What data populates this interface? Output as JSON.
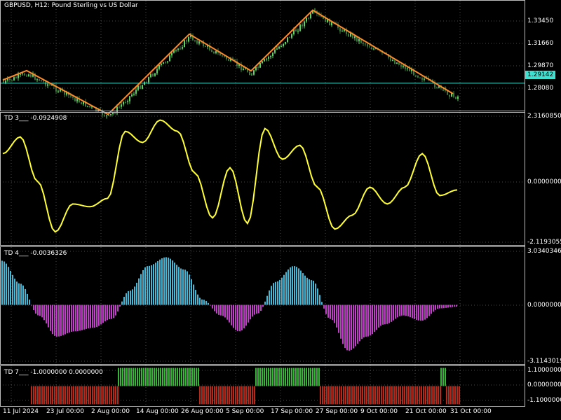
{
  "window": {
    "title": "GBPUSD, H12:  Pound Sterling vs US Dollar",
    "current_price": "1.29142"
  },
  "colors": {
    "background": "#000000",
    "grid": "#4a4a4a",
    "candle_up": "#5fd35f",
    "candle_down": "#3a7a3a",
    "zigzag": "#ff8a2a",
    "price_line": "#40e0d0",
    "td3_line": "#ffff33",
    "td4_pos": "#44b8d4",
    "td4_neg": "#c040c8",
    "td7_pos": "#36b536",
    "td7_neg": "#b52a1a"
  },
  "price_axis": [
    "1.33450",
    "1.31660",
    "1.29870",
    "1.28080"
  ],
  "time_axis": [
    "11 Jul 2024",
    "23 Jul 00:00",
    "2 Aug 00:00",
    "14 Aug 00:00",
    "26 Aug 00:00",
    "5 Sep 00:00",
    "17 Sep 00:00",
    "27 Sep 00:00",
    "9 Oct 00:00",
    "21 Oct 00:00",
    "31 Oct 00:00"
  ],
  "panels": {
    "td3": {
      "label": "TD 3___  -0.0924908",
      "axis": [
        "2.3160850",
        "0.0000000",
        "-2.1193055"
      ]
    },
    "td4": {
      "label": "TD 4___  -0.0036326",
      "axis": [
        "3.0340346",
        "0.0000000",
        "-3.1143019"
      ]
    },
    "td7": {
      "label": "TD 7___  -1.0000000 0.0000000",
      "axis": [
        "1.1000000",
        "0.0000000",
        "-1.1000000"
      ]
    }
  },
  "chart_data": {
    "type": "line",
    "x": [
      "11 Jul 2024",
      "23 Jul 00:00",
      "2 Aug 00:00",
      "14 Aug 00:00",
      "26 Aug 00:00",
      "5 Sep 00:00",
      "17 Sep 00:00",
      "27 Sep 00:00",
      "9 Oct 00:00",
      "21 Oct 00:00",
      "31 Oct 00:00"
    ],
    "zigzag_price": [
      {
        "x": "11 Jul 2024",
        "y": 1.2937
      },
      {
        "x": "18 Jul 2024",
        "y": 1.3004
      },
      {
        "x": "5 Aug 2024",
        "y": 1.2693
      },
      {
        "x": "27 Aug 2024",
        "y": 1.3263
      },
      {
        "x": "11 Sep 2024",
        "y": 1.3002
      },
      {
        "x": "26 Sep 2024",
        "y": 1.3433
      },
      {
        "x": "31 Oct 2024",
        "y": 1.284
      }
    ],
    "td3_values": [
      1.0,
      1.6,
      0.0,
      -1.8,
      -0.8,
      -0.9,
      -0.6,
      1.8,
      1.4,
      2.2,
      1.8,
      0.3,
      -1.3,
      0.5,
      -1.5,
      1.9,
      0.8,
      1.3,
      -0.2,
      -1.7,
      -1.2,
      -0.2,
      -0.8,
      -0.2,
      1.0,
      -0.5,
      -0.3
    ],
    "td4_values": [
      2.5,
      1.2,
      -0.6,
      -1.8,
      -1.5,
      -1.3,
      -0.8,
      0.8,
      2.2,
      2.7,
      2.0,
      0.3,
      -0.6,
      -1.5,
      -0.5,
      1.3,
      2.2,
      1.4,
      -0.8,
      -2.6,
      -1.8,
      -1.1,
      -0.6,
      -0.9,
      -0.2,
      -0.1
    ],
    "td7_values": [
      -1,
      1,
      -1,
      1,
      -1,
      1,
      -1
    ],
    "ylim_price": [
      1.272,
      1.35
    ],
    "ylim_td3": [
      -2.1193055,
      2.316085
    ],
    "ylim_td4": [
      -3.1143019,
      3.0340346
    ],
    "ylim_td7": [
      -1.1,
      1.1
    ]
  }
}
